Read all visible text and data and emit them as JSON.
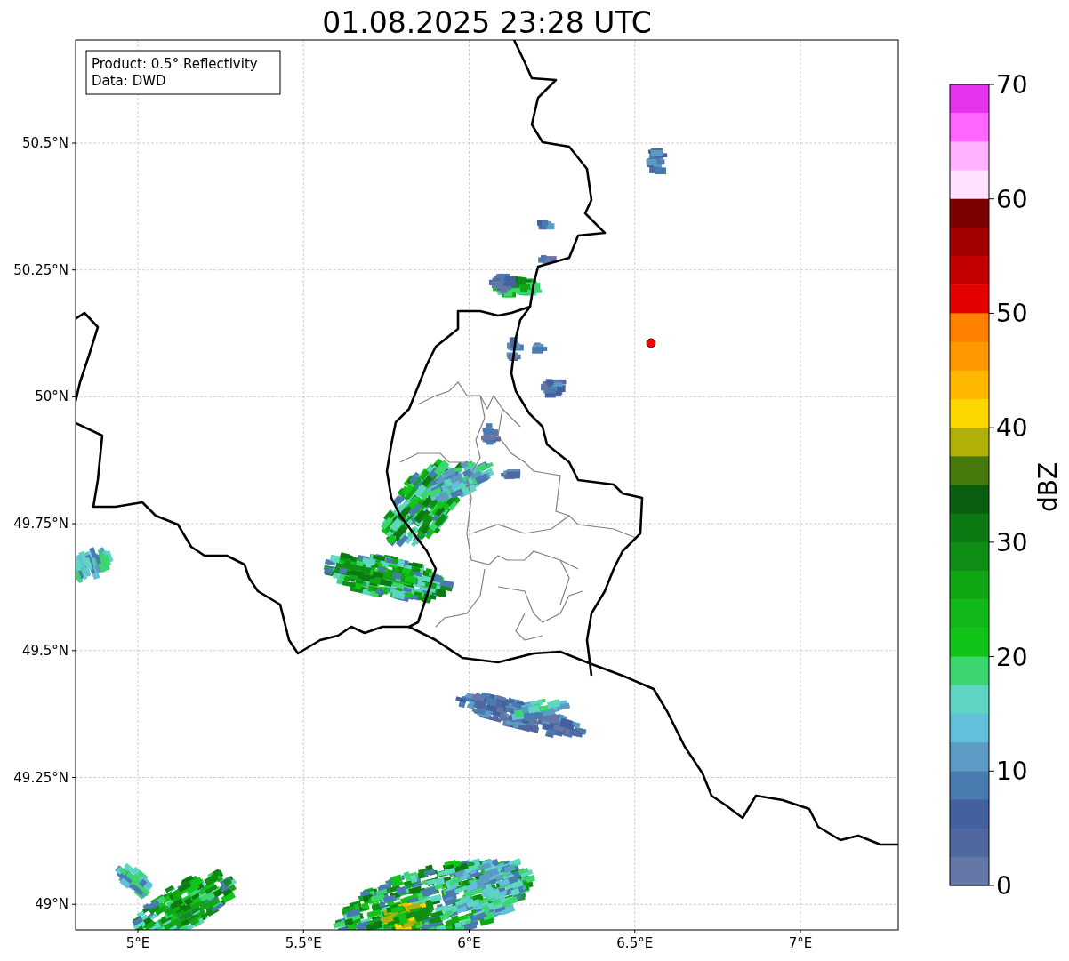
{
  "title": "01.08.2025 23:28 UTC",
  "map": {
    "info_box": [
      "Product: 0.5° Reflectivity",
      "Data: DWD"
    ],
    "lat_ticks": [
      "50.5°N",
      "50.25°N",
      "50°N",
      "49.75°N",
      "49.5°N",
      "49.25°N",
      "49°N"
    ],
    "lon_ticks": [
      "5°E",
      "5.5°E",
      "6°E",
      "6.5°E",
      "7°E"
    ],
    "marker": {
      "color": "#ff0000"
    }
  },
  "colorbar": {
    "label": "dBZ",
    "ticks": [
      "70",
      "60",
      "50",
      "40",
      "30",
      "20",
      "10",
      "0"
    ],
    "bands": [
      {
        "color": "#e633ee"
      },
      {
        "color": "#ff66ff"
      },
      {
        "color": "#ffb3ff"
      },
      {
        "color": "#ffe0ff"
      },
      {
        "color": "#7a0000"
      },
      {
        "color": "#a00000"
      },
      {
        "color": "#c20000"
      },
      {
        "color": "#e30000"
      },
      {
        "color": "#ff7f00"
      },
      {
        "color": "#ff9900"
      },
      {
        "color": "#ffb800"
      },
      {
        "color": "#ffd700"
      },
      {
        "color": "#b0b008"
      },
      {
        "color": "#467a0c"
      },
      {
        "color": "#0a5e10"
      },
      {
        "color": "#0c7a12"
      },
      {
        "color": "#0e8e14"
      },
      {
        "color": "#10a614"
      },
      {
        "color": "#10b818"
      },
      {
        "color": "#11c418"
      },
      {
        "color": "#3cd66e"
      },
      {
        "color": "#5fd6c4"
      },
      {
        "color": "#63c0da"
      },
      {
        "color": "#5b9bc4"
      },
      {
        "color": "#4a7bb0"
      },
      {
        "color": "#4360a0"
      },
      {
        "color": "#5068a0"
      },
      {
        "color": "#6577a6"
      }
    ]
  }
}
